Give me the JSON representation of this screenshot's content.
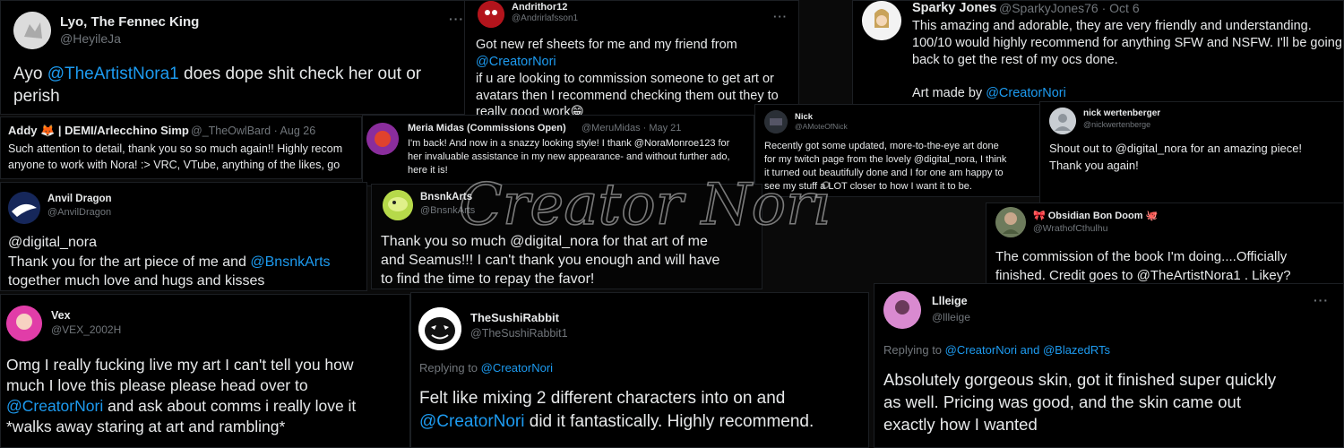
{
  "colors": {
    "link": "#1d9bf0",
    "muted": "#71767b",
    "text": "#e7e9ea",
    "bg": "#000000"
  },
  "watermark": "Creator Nori",
  "tweets": {
    "lyo": {
      "name": "Lyo, The Fennec King",
      "handle": "@HeyileJa",
      "line1_a": "Ayo ",
      "line1_link": "@TheArtistNora1",
      "line1_b": " does dope shit check her out or",
      "line2": "perish"
    },
    "andrithor": {
      "name": "Andrithor12",
      "handle": "@Andrirlafsson1",
      "line1": "Got new ref sheets for me and my friend from",
      "line2_link": "@CreatorNori",
      "line3": "if u are looking to commission someone to get art or",
      "line4": "avatars then I recommend checking them out they to",
      "line5": "really good work😁"
    },
    "sparky": {
      "name": "Sparky Jones",
      "handle": "@SparkyJones76 · Oct 6",
      "line1": "This amazing and adorable, they are very friendly and understanding.",
      "line2": "100/10 would highly recommend for anything SFW and NSFW. I'll be going",
      "line3": "back to get the rest of my ocs done.",
      "line4_a": "Art made by ",
      "line4_link": "@CreatorNori"
    },
    "addy": {
      "name": "Addy 🦊 | DEMI/Arlecchino Simp",
      "handle": "@_TheOwlBard · Aug 26",
      "line1": "Such attention to detail, thank you so so much again!! Highly recom",
      "line2": "anyone to work with Nora! :> VRC, VTube, anything of the likes, go"
    },
    "meria": {
      "name": "Meria Midas (Commissions Open)",
      "handle": "@MeruMidas · May 21",
      "line1": "I'm back! And now in a snazzy looking style! I thank @NoraMonroe123 for",
      "line2": "her invaluable assistance in my new appearance- and without further ado,",
      "line3": "here it is!"
    },
    "nick": {
      "name": "Nick",
      "handle": "@AMoteOfNick",
      "line1": "Recently got some updated, more-to-the-eye art done",
      "line2": "for my twitch page from the lovely @digital_nora, I think",
      "line3": "it turned out beautifully done and I for one am happy to",
      "line4": "see my stuff a LOT closer to how I want it to be."
    },
    "nickw": {
      "name": "nick wertenberger",
      "handle": "@nickwertenberge",
      "line1": "Shout out to @digital_nora  for an amazing piece!",
      "line2": "Thank you again!"
    },
    "anvil": {
      "name": "Anvil Dragon",
      "handle": "@AnvilDragon",
      "line1": "@digital_nora",
      "line2_a": "Thank you for the art piece of me and ",
      "line2_link": "@BnsnkArts",
      "line3": "together much love and hugs and kisses"
    },
    "bnsnk": {
      "name": "BnsnkArts",
      "handle": "@BnsnkArts",
      "line1": "Thank you so much @digital_nora for that art of me",
      "line2": "and Seamus!!! I can't thank you enough and will have",
      "line3": "to find the time to repay the favor!"
    },
    "obsidian": {
      "name": "🎀 Obsidian Bon Doom 🐙",
      "handle": "@WrathofCthulhu",
      "line1": "The commission of the book I'm doing....Officially",
      "line2": "finished. Credit goes to @TheArtistNora1 . Likey?"
    },
    "vex": {
      "name": "Vex",
      "handle": "@VEX_2002H",
      "line1": "Omg I really fucking live my art I can't tell you how",
      "line2": "much I love this please please head over to",
      "line3_link": "@CreatorNori",
      "line3_b": " and ask about comms i really love it",
      "line4": "*walks away staring at art and rambling*"
    },
    "sushi": {
      "name": "TheSushiRabbit",
      "handle": "@TheSushiRabbit1",
      "reply_a": "Replying to ",
      "reply_link": "@CreatorNori",
      "line1": "Felt like mixing 2 different characters into on and",
      "line2_link": "@CreatorNori",
      "line2_b": " did it fantastically. Highly recommend."
    },
    "llleige": {
      "name": "Llleige",
      "handle": "@llleige",
      "reply_a": "Replying to ",
      "reply_link": "@CreatorNori and @BlazedRTs",
      "line1": "Absolutely gorgeous skin, got it finished super quickly",
      "line2": "as well. Pricing was good, and the skin came out",
      "line3": "exactly how I wanted"
    },
    "more": "···"
  }
}
